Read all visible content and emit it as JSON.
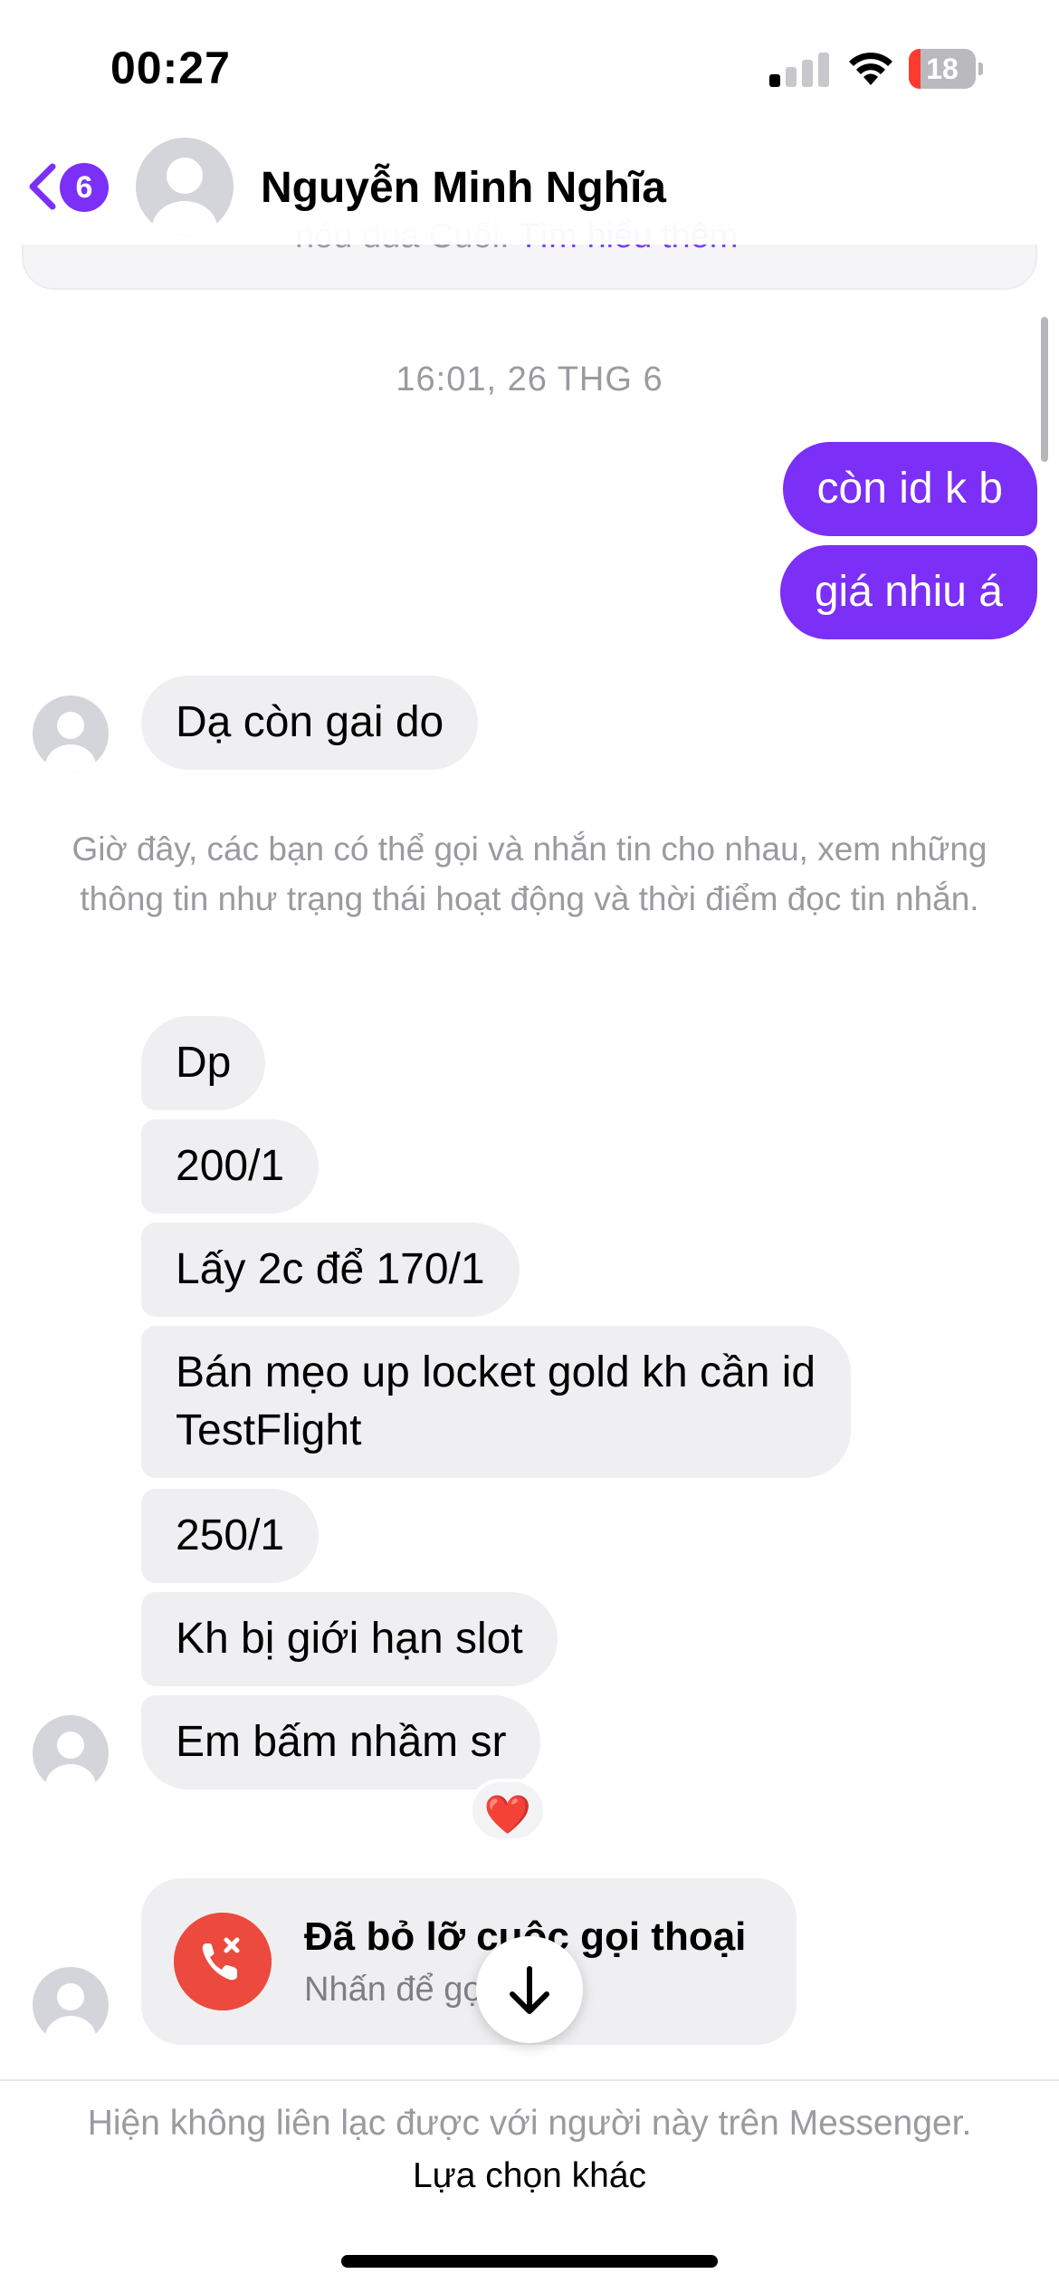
{
  "status_bar": {
    "time": "00:27",
    "battery_level": "18",
    "battery_fraction": 0.18,
    "signal_bars": 1
  },
  "header": {
    "back_badge": "6",
    "contact_name": "Nguyễn Minh Nghĩa"
  },
  "info_card": {
    "partial_text": "nóu dua Cuối.",
    "partial_link": "Tìm hiểu thêm"
  },
  "conversation": {
    "timestamp": "16:01, 26 THG 6",
    "outgoing": [
      {
        "text": "còn id k b"
      },
      {
        "text": "giá nhiu á"
      }
    ],
    "incoming_first": {
      "text": "Dạ còn gai do"
    },
    "system_note": "Giờ đây, các bạn có thể gọi và nhắn tin cho nhau, xem những thông tin như trạng thái hoạt động và thời điểm đọc tin nhắn.",
    "incoming_group": [
      {
        "text": "Dp"
      },
      {
        "text": "200/1"
      },
      {
        "text": "Lấy 2c để 170/1"
      },
      {
        "text": "Bán mẹo up locket gold kh cần id TestFlight"
      },
      {
        "text": "250/1"
      },
      {
        "text": "Kh bị giới hạn slot"
      },
      {
        "text": "Em bấm nhầm sr"
      }
    ],
    "reaction": "❤️",
    "missed_call": {
      "title": "Đã bỏ lỡ cuộc gọi thoại",
      "subtitle": "Nhấn để gọi lại"
    }
  },
  "footer": {
    "notice": "Hiện không liên lạc được với người này trên Messenger.",
    "action": "Lựa chọn khác"
  },
  "colors": {
    "accent": "#7b2ff7",
    "incoming_bubble": "#efeff1",
    "missed_call_red": "#ec4a3f"
  }
}
